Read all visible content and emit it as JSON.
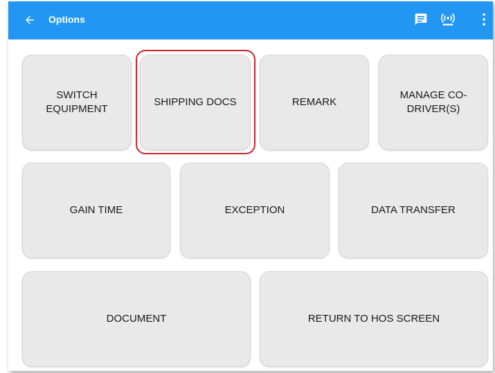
{
  "appbar": {
    "title": "Options",
    "back_icon": "arrow-left-icon",
    "message_icon": "message-icon",
    "signal_icon": "wireless-signal-icon",
    "overflow_icon": "more-vert-icon",
    "color": "#2196f3"
  },
  "buttons": {
    "switch_equipment": {
      "line1": "SWITCH",
      "line2": "EQUIPMENT"
    },
    "shipping_docs": "SHIPPING DOCS",
    "remark": "REMARK",
    "manage_co_driver": {
      "line1": "MANAGE CO-",
      "line2": "DRIVER(S)"
    },
    "gain_time": "GAIN TIME",
    "exception": "EXCEPTION",
    "data_transfer": "DATA TRANSFER",
    "document": "DOCUMENT",
    "return_to_hos": "RETURN TO HOS SCREEN"
  },
  "highlight_color": "#d0202b"
}
